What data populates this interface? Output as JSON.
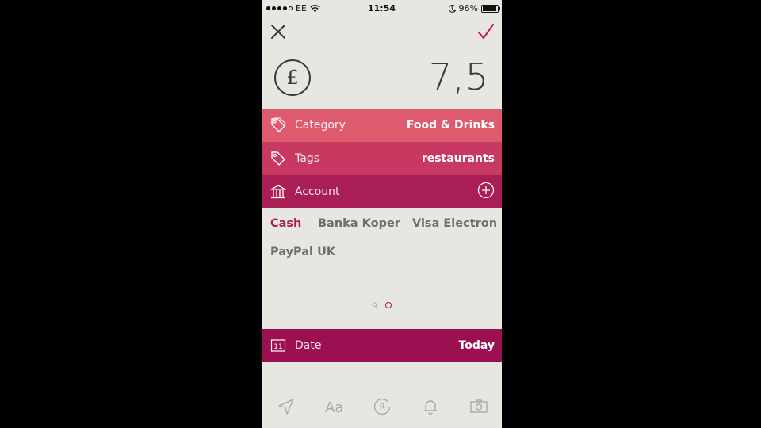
{
  "status_bar": {
    "carrier": "EE",
    "time": "11:54",
    "battery": "96%",
    "battery_level": 0.96
  },
  "amount": {
    "currency_symbol": "£",
    "value": "7,5"
  },
  "rows": {
    "category": {
      "label": "Category",
      "value": "Food & Drinks"
    },
    "tags": {
      "label": "Tags",
      "value": "restaurants"
    },
    "account": {
      "label": "Account"
    },
    "date": {
      "label": "Date",
      "value": "Today",
      "icon_text": "11"
    }
  },
  "accounts": [
    "Cash",
    "Banka Koper",
    "Visa Electron",
    "PayPal UK"
  ],
  "selected_account": "Cash",
  "colors": {
    "category": "#dd5a6f",
    "tags": "#c73960",
    "account": "#a81e55",
    "date": "#9b1050",
    "accent": "#c8245a",
    "background": "#e8e6e1"
  },
  "toolbar_icons": [
    "location-icon",
    "text-format-icon",
    "recurring-icon",
    "reminder-bell-icon",
    "camera-icon"
  ]
}
